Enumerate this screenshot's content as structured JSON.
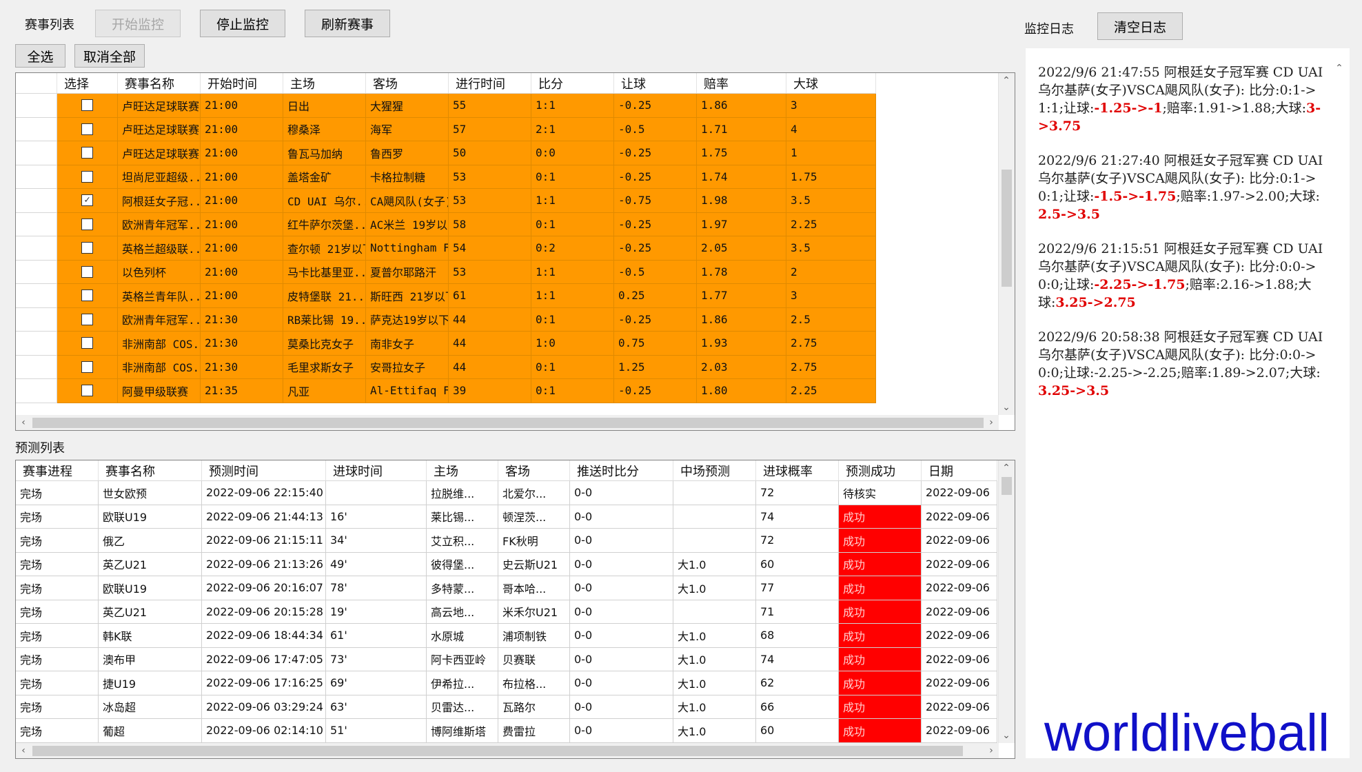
{
  "toolbar": {
    "match_list_label": "赛事列表",
    "start_monitor": "开始监控",
    "stop_monitor": "停止监控",
    "refresh_matches": "刷新赛事",
    "select_all": "全选",
    "deselect_all": "取消全部",
    "monitor_log_label": "监控日志",
    "clear_log": "清空日志"
  },
  "matches": {
    "columns": [
      "选择",
      "赛事名称",
      "开始时间",
      "主场",
      "客场",
      "进行时间",
      "比分",
      "让球",
      "赔率",
      "大球"
    ],
    "rows": [
      {
        "checked": false,
        "league": "卢旺达足球联赛",
        "start": "21:00",
        "home": "日出",
        "away": "大猩猩",
        "elapsed": "55",
        "score": "1:1",
        "handicap": "-0.25",
        "odds": "1.86",
        "over": "3"
      },
      {
        "checked": false,
        "league": "卢旺达足球联赛",
        "start": "21:00",
        "home": "穆桑泽",
        "away": "海军",
        "elapsed": "57",
        "score": "2:1",
        "handicap": "-0.5",
        "odds": "1.71",
        "over": "4"
      },
      {
        "checked": false,
        "league": "卢旺达足球联赛",
        "start": "21:00",
        "home": "鲁瓦马加纳",
        "away": "鲁西罗",
        "elapsed": "50",
        "score": "0:0",
        "handicap": "-0.25",
        "odds": "1.75",
        "over": "1"
      },
      {
        "checked": false,
        "league": "坦尚尼亚超级...",
        "start": "21:00",
        "home": "盖塔金矿",
        "away": "卡格拉制糖",
        "elapsed": "53",
        "score": "0:1",
        "handicap": "-0.25",
        "odds": "1.74",
        "over": "1.75"
      },
      {
        "checked": true,
        "league": "阿根廷女子冠...",
        "start": "21:00",
        "home": "CD UAI 乌尔...",
        "away": "CA飓风队(女子)",
        "elapsed": "53",
        "score": "1:1",
        "handicap": "-0.75",
        "odds": "1.98",
        "over": "3.5"
      },
      {
        "checked": false,
        "league": "欧洲青年冠军...",
        "start": "21:00",
        "home": "红牛萨尔茨堡...",
        "away": "AC米兰 19岁以下",
        "elapsed": "58",
        "score": "0:1",
        "handicap": "-0.25",
        "odds": "1.97",
        "over": "2.25"
      },
      {
        "checked": false,
        "league": "英格兰超级联...",
        "start": "21:00",
        "home": "查尔顿 21岁以下",
        "away": "Nottingham F...",
        "elapsed": "54",
        "score": "0:2",
        "handicap": "-0.25",
        "odds": "2.05",
        "over": "3.5"
      },
      {
        "checked": false,
        "league": "以色列杯",
        "start": "21:00",
        "home": "马卡比基里亚...",
        "away": "夏普尔耶路汗",
        "elapsed": "53",
        "score": "1:1",
        "handicap": "-0.5",
        "odds": "1.78",
        "over": "2"
      },
      {
        "checked": false,
        "league": "英格兰青年队...",
        "start": "21:00",
        "home": "皮特堡联 21...",
        "away": "斯旺西 21岁以下",
        "elapsed": "61",
        "score": "1:1",
        "handicap": "0.25",
        "odds": "1.77",
        "over": "3"
      },
      {
        "checked": false,
        "league": "欧洲青年冠军...",
        "start": "21:30",
        "home": "RB莱比锡 19...",
        "away": "萨克达19岁以下",
        "elapsed": "44",
        "score": "0:1",
        "handicap": "-0.25",
        "odds": "1.86",
        "over": "2.5"
      },
      {
        "checked": false,
        "league": "非洲南部 COS...",
        "start": "21:30",
        "home": "莫桑比克女子",
        "away": "南非女子",
        "elapsed": "44",
        "score": "1:0",
        "handicap": "0.75",
        "odds": "1.93",
        "over": "2.75"
      },
      {
        "checked": false,
        "league": "非洲南部 COS...",
        "start": "21:30",
        "home": "毛里求斯女子",
        "away": "安哥拉女子",
        "elapsed": "44",
        "score": "0:1",
        "handicap": "1.25",
        "odds": "2.03",
        "over": "2.75"
      },
      {
        "checked": false,
        "league": "阿曼甲级联赛",
        "start": "21:35",
        "home": "凡亚",
        "away": "Al-Ettifaq FC",
        "elapsed": "39",
        "score": "0:1",
        "handicap": "-0.25",
        "odds": "1.80",
        "over": "2.25"
      }
    ]
  },
  "predictions": {
    "label": "预测列表",
    "columns": [
      "赛事进程",
      "赛事名称",
      "预测时间",
      "进球时间",
      "主场",
      "客场",
      "推送时比分",
      "中场预测",
      "进球概率",
      "预测成功",
      "日期"
    ],
    "rows": [
      {
        "status": "完场",
        "league": "世女欧预",
        "time": "2022-09-06 22:15:40",
        "goal": "",
        "home": "拉脱维...",
        "away": "北爱尔...",
        "score": "0-0",
        "half": "",
        "prob": "72",
        "result": "待核实",
        "date": "2022-09-06",
        "ok": false
      },
      {
        "status": "完场",
        "league": "欧联U19",
        "time": "2022-09-06 21:44:13",
        "goal": "16'",
        "home": "莱比锡...",
        "away": "顿涅茨...",
        "score": "0-0",
        "half": "",
        "prob": "74",
        "result": "成功",
        "date": "2022-09-06",
        "ok": true
      },
      {
        "status": "完场",
        "league": "俄乙",
        "time": "2022-09-06 21:15:11",
        "goal": "34'",
        "home": "艾立积...",
        "away": "FK秋明",
        "score": "0-0",
        "half": "",
        "prob": "72",
        "result": "成功",
        "date": "2022-09-06",
        "ok": true
      },
      {
        "status": "完场",
        "league": "英乙U21",
        "time": "2022-09-06 21:13:26",
        "goal": "49'",
        "home": "彼得堡...",
        "away": "史云斯U21",
        "score": "0-0",
        "half": "大1.0",
        "prob": "60",
        "result": "成功",
        "date": "2022-09-06",
        "ok": true
      },
      {
        "status": "完场",
        "league": "欧联U19",
        "time": "2022-09-06 20:16:07",
        "goal": "78'",
        "home": "多特蒙...",
        "away": "哥本哈...",
        "score": "0-0",
        "half": "大1.0",
        "prob": "77",
        "result": "成功",
        "date": "2022-09-06",
        "ok": true
      },
      {
        "status": "完场",
        "league": "英乙U21",
        "time": "2022-09-06 20:15:28",
        "goal": "19'",
        "home": "高云地...",
        "away": "米禾尔U21",
        "score": "0-0",
        "half": "",
        "prob": "71",
        "result": "成功",
        "date": "2022-09-06",
        "ok": true
      },
      {
        "status": "完场",
        "league": "韩K联",
        "time": "2022-09-06 18:44:34",
        "goal": "61'",
        "home": "水原城",
        "away": "浦项制铁",
        "score": "0-0",
        "half": "大1.0",
        "prob": "68",
        "result": "成功",
        "date": "2022-09-06",
        "ok": true
      },
      {
        "status": "完场",
        "league": "澳布甲",
        "time": "2022-09-06 17:47:05",
        "goal": "73'",
        "home": "阿卡西亚岭",
        "away": "贝赛联",
        "score": "0-0",
        "half": "大1.0",
        "prob": "74",
        "result": "成功",
        "date": "2022-09-06",
        "ok": true
      },
      {
        "status": "完场",
        "league": "捷U19",
        "time": "2022-09-06 17:16:25",
        "goal": "69'",
        "home": "伊希拉...",
        "away": "布拉格...",
        "score": "0-0",
        "half": "大1.0",
        "prob": "62",
        "result": "成功",
        "date": "2022-09-06",
        "ok": true
      },
      {
        "status": "完场",
        "league": "冰岛超",
        "time": "2022-09-06 03:29:24",
        "goal": "63'",
        "home": "贝雷达...",
        "away": "瓦路尔",
        "score": "0-0",
        "half": "大1.0",
        "prob": "66",
        "result": "成功",
        "date": "2022-09-06",
        "ok": true
      },
      {
        "status": "完场",
        "league": "葡超",
        "time": "2022-09-06 02:14:10",
        "goal": "51'",
        "home": "博阿维斯塔",
        "away": "费雷拉",
        "score": "0-0",
        "half": "大1.0",
        "prob": "60",
        "result": "成功",
        "date": "2022-09-06",
        "ok": true
      }
    ]
  },
  "log": {
    "entries": [
      {
        "prefix": "2022/9/6 21:47:55 阿根廷女子冠军赛 CD UAI 乌尔基萨(女子)VSCA飓风队(女子): 比分:0:1->1:1;让球:",
        "hl1": "-1.25->-1",
        "mid": ";赔率:1.91->1.88;大球:",
        "hl2": "3->3.75"
      },
      {
        "prefix": "2022/9/6 21:27:40 阿根廷女子冠军赛 CD UAI 乌尔基萨(女子)VSCA飓风队(女子): 比分:0:1->0:1;让球:",
        "hl1": "-1.5->-1.75",
        "mid": ";赔率:1.97->2.00;大球:",
        "hl2": "2.5->3.5"
      },
      {
        "prefix": "2022/9/6 21:15:51 阿根廷女子冠军赛 CD UAI 乌尔基萨(女子)VSCA飓风队(女子): 比分:0:0->0:0;让球:",
        "hl1": "-2.25->-1.75",
        "mid": ";赔率:2.16->1.88;大球:",
        "hl2": "3.25->2.75"
      },
      {
        "prefix": "2022/9/6 20:58:38 阿根廷女子冠军赛 CD UAI 乌尔基萨(女子)VSCA飓风队(女子): 比分:0:0->0:0;让球:-2.25->-2.25;赔率:1.89->2.07;大球:",
        "hl1": "",
        "mid": "",
        "hl2": "3.25->3.5"
      }
    ]
  },
  "watermark": "worldliveball",
  "colors": {
    "row_highlight": "#ff9900",
    "success": "#ff0000",
    "log_highlight": "#e00000",
    "watermark": "#1010c8"
  }
}
